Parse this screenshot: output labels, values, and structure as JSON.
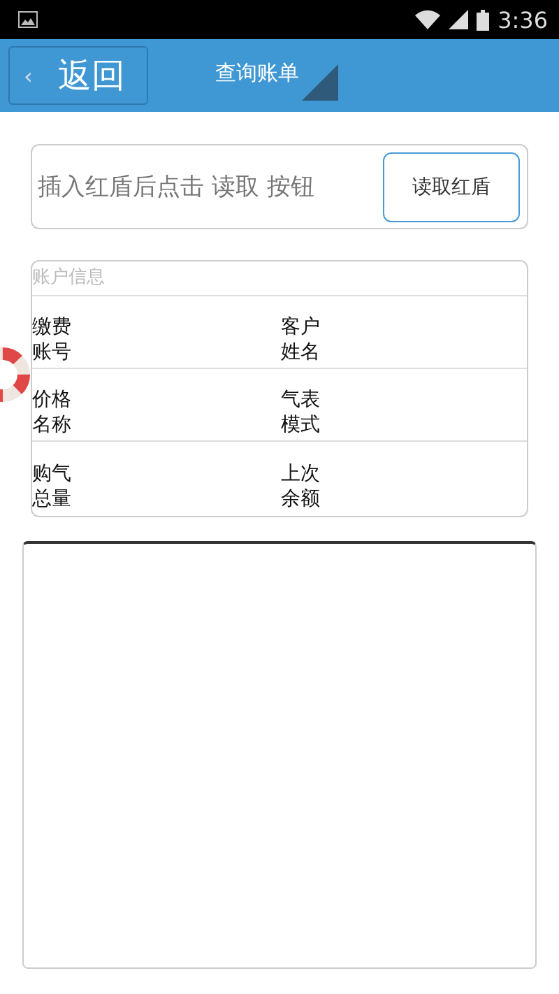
{
  "status_bar": {
    "time": "3:36"
  },
  "action_bar": {
    "back": {
      "arrow": "‹",
      "label": "返回"
    },
    "title": "查询账单"
  },
  "reader": {
    "placeholder": "插入红盾后点击 读取 按钮",
    "button": "读取红盾"
  },
  "account_info": {
    "title": "账户信息",
    "rows": [
      {
        "left": "缴费账号",
        "right": "客户姓名"
      },
      {
        "left": "价格名称",
        "right": "气表模式"
      },
      {
        "left": "购气总量",
        "right": "上次余额"
      }
    ]
  }
}
